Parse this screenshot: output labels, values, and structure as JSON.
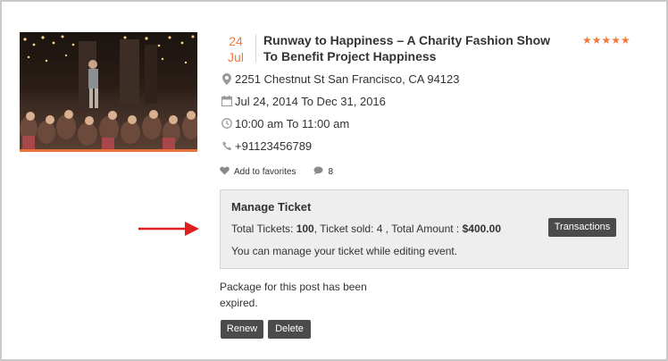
{
  "event": {
    "date_day": "24",
    "date_month": "Jul",
    "title": "Runway to Happiness – A Charity Fashion Show To Benefit Project Happiness",
    "rating_stars": "★★★★★",
    "rating": 5,
    "address": "2251 Chestnut St San Francisco, CA 94123",
    "date_range": "Jul 24, 2014 To Dec 31, 2016",
    "time_range": "10:00 am To 11:00 am",
    "phone": "+91123456789",
    "favorites_label": "Add to favorites",
    "comments_count": "8"
  },
  "manage": {
    "title": "Manage Ticket",
    "total_tickets_label": "Total Tickets: ",
    "total_tickets": "100",
    "ticket_sold_text": ", Ticket sold: 4 , Total Amount : ",
    "total_amount": "$400.00",
    "transactions_label": "Transactions",
    "note": "You can manage your ticket while editing event."
  },
  "package": {
    "message": "Package for this post has been expired.",
    "renew_label": "Renew",
    "delete_label": "Delete"
  },
  "colors": {
    "accent": "#ef7a3c",
    "button_bg": "#4b4b4b",
    "arrow": "#e02020"
  },
  "icons": {
    "location": "map-pin-icon",
    "calendar": "calendar-icon",
    "time": "clock-icon",
    "phone": "phone-icon",
    "favorite": "heart-icon",
    "comments": "comment-icon"
  }
}
